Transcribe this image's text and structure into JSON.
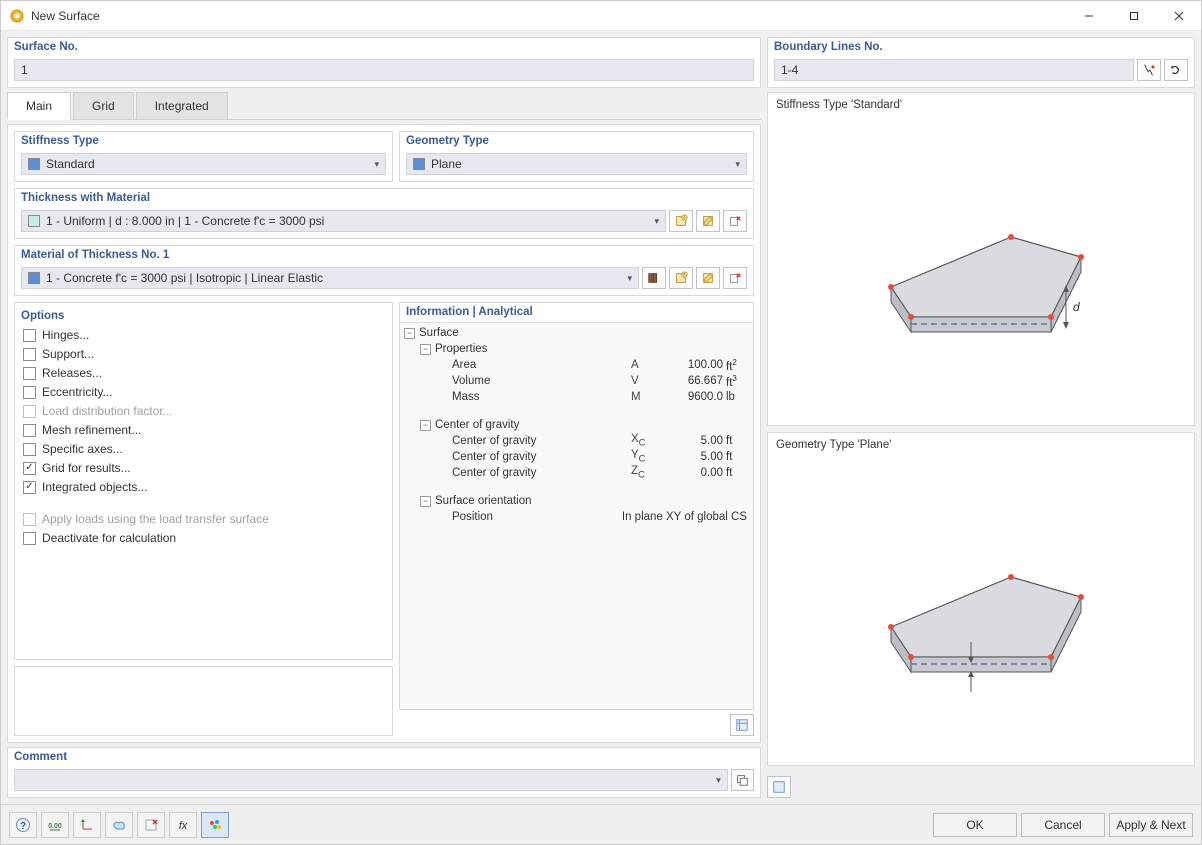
{
  "window": {
    "title": "New Surface"
  },
  "surface_no": {
    "label": "Surface No.",
    "value": "1"
  },
  "boundary": {
    "label": "Boundary Lines No.",
    "value": "1-4"
  },
  "tabs": {
    "main": "Main",
    "grid": "Grid",
    "integrated": "Integrated"
  },
  "stiffness": {
    "label": "Stiffness Type",
    "value": "Standard"
  },
  "geometry": {
    "label": "Geometry Type",
    "value": "Plane"
  },
  "thickness": {
    "label": "Thickness with Material",
    "value": "1 - Uniform | d : 8.000 in | 1 - Concrete f'c = 3000 psi"
  },
  "material": {
    "label": "Material of Thickness No. 1",
    "value": "1 - Concrete f'c = 3000 psi | Isotropic | Linear Elastic"
  },
  "options": {
    "label": "Options",
    "hinges": "Hinges...",
    "support": "Support...",
    "releases": "Releases...",
    "eccentricity": "Eccentricity...",
    "load_dist": "Load distribution factor...",
    "mesh": "Mesh refinement...",
    "specific_axes": "Specific axes...",
    "grid_results": "Grid for results...",
    "integrated_obj": "Integrated objects...",
    "apply_loads": "Apply loads using the load transfer surface",
    "deactivate": "Deactivate for calculation"
  },
  "info": {
    "header": "Information | Analytical",
    "surface": "Surface",
    "properties": "Properties",
    "area": {
      "label": "Area",
      "sym": "A",
      "val": "100.00",
      "unit_base": "ft",
      "unit_sup": "2"
    },
    "volume": {
      "label": "Volume",
      "sym": "V",
      "val": "66.667",
      "unit_base": "ft",
      "unit_sup": "3"
    },
    "mass": {
      "label": "Mass",
      "sym": "M",
      "val": "9600.0",
      "unit_base": "lb",
      "unit_sup": ""
    },
    "cog_header": "Center of gravity",
    "cog_x": {
      "label": "Center of gravity",
      "sym": "X",
      "sub": "C",
      "val": "5.00",
      "unit": "ft"
    },
    "cog_y": {
      "label": "Center of gravity",
      "sym": "Y",
      "sub": "C",
      "val": "5.00",
      "unit": "ft"
    },
    "cog_z": {
      "label": "Center of gravity",
      "sym": "Z",
      "sub": "C",
      "val": "0.00",
      "unit": "ft"
    },
    "orient_header": "Surface orientation",
    "position": {
      "label": "Position",
      "val": "In plane XY of global CS"
    }
  },
  "comment": {
    "label": "Comment",
    "value": ""
  },
  "preview": {
    "stiffness_title": "Stiffness Type 'Standard'",
    "geometry_title": "Geometry Type 'Plane'"
  },
  "buttons": {
    "ok": "OK",
    "cancel": "Cancel",
    "apply_next": "Apply & Next"
  }
}
